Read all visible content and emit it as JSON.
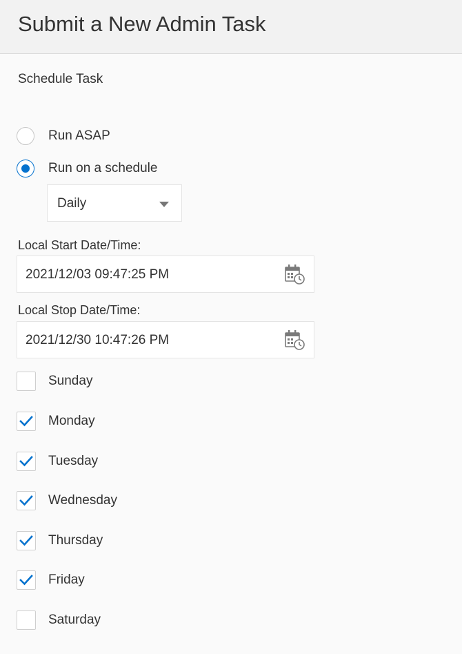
{
  "header": {
    "title": "Submit a New Admin Task"
  },
  "schedule": {
    "section_label": "Schedule Task",
    "options": [
      {
        "label": "Run ASAP",
        "selected": false
      },
      {
        "label": "Run on a schedule",
        "selected": true
      }
    ],
    "frequency": "Daily"
  },
  "start": {
    "label": "Local Start Date/Time:",
    "value": "2021/12/03 09:47:25 PM",
    "icon": "calendar-clock-icon"
  },
  "stop": {
    "label": "Local Stop Date/Time:",
    "value": "2021/12/30 10:47:26 PM",
    "icon": "calendar-clock-icon"
  },
  "days": [
    {
      "label": "Sunday",
      "checked": false
    },
    {
      "label": "Monday",
      "checked": true
    },
    {
      "label": "Tuesday",
      "checked": true
    },
    {
      "label": "Wednesday",
      "checked": true
    },
    {
      "label": "Thursday",
      "checked": true
    },
    {
      "label": "Friday",
      "checked": true
    },
    {
      "label": "Saturday",
      "checked": false
    }
  ],
  "colors": {
    "accent": "#0572ce",
    "header_bg": "#f2f2f2",
    "page_bg": "#fafafa",
    "icon": "#7a7a7a"
  }
}
